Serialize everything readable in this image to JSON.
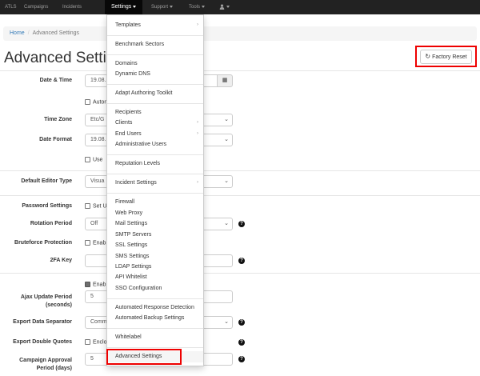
{
  "navbar": {
    "brand": "ATLS",
    "items": [
      "Campaigns",
      "Incidents",
      "Settings",
      "Support",
      "Tools"
    ],
    "user_icon": "user-icon"
  },
  "breadcrumb": {
    "home": "Home",
    "current": "Advanced Settings"
  },
  "page": {
    "title": "Advanced Settings",
    "factory_reset": "Factory Reset"
  },
  "form": {
    "date_time": {
      "label": "Date & Time",
      "value": "19.08."
    },
    "auto_checkbox": "Auton",
    "time_zone": {
      "label": "Time Zone",
      "value": "Etc/G"
    },
    "date_format": {
      "label": "Date Format",
      "value": "19.08."
    },
    "use_checkbox": "Use",
    "default_editor": {
      "label": "Default Editor Type",
      "value": "Visua"
    },
    "password_settings": {
      "label": "Password Settings",
      "checkbox": "Set U"
    },
    "rotation_period": {
      "label": "Rotation Period",
      "value": "Off"
    },
    "bruteforce": {
      "label": "Bruteforce Protection",
      "checkbox": "Enab"
    },
    "twofa": {
      "label": "2FA Key",
      "value": ""
    },
    "ajax_enable": "Enab",
    "ajax": {
      "label_line1": "Ajax Update Period",
      "label_line2": "(seconds)",
      "value": "5"
    },
    "export_separator": {
      "label": "Export Data Separator",
      "value": "Comm"
    },
    "export_quotes": {
      "label": "Export Double Quotes",
      "checkbox": "Enclo"
    },
    "campaign_approval": {
      "label_line1": "Campaign Approval",
      "label_line2": "Period (days)",
      "value": "5"
    }
  },
  "dropdown": {
    "items": [
      {
        "label": "Templates",
        "sub": true
      },
      {
        "label": "Benchmark Sectors"
      },
      {
        "label": "Domains"
      },
      {
        "label": "Dynamic DNS"
      },
      {
        "label": "Adapt Authoring Toolkit"
      },
      {
        "label": "Recipients"
      },
      {
        "label": "Clients",
        "sub": true
      },
      {
        "label": "End Users",
        "sub": true
      },
      {
        "label": "Administrative Users"
      },
      {
        "label": "Reputation Levels"
      },
      {
        "label": "Incident Settings",
        "sub": true
      },
      {
        "label": "Firewall"
      },
      {
        "label": "Web Proxy"
      },
      {
        "label": "Mail Settings"
      },
      {
        "label": "SMTP Servers"
      },
      {
        "label": "SSL Settings"
      },
      {
        "label": "SMS Settings"
      },
      {
        "label": "LDAP Settings"
      },
      {
        "label": "API Whitelist"
      },
      {
        "label": "SSO Configuration"
      },
      {
        "label": "Automated Response Detection"
      },
      {
        "label": "Automated Backup Settings"
      },
      {
        "label": "Whitelabel"
      },
      {
        "label": "Advanced Settings"
      }
    ]
  },
  "colors": {
    "navbar": "#222222",
    "link": "#337ab7",
    "highlight": "#ee0000"
  }
}
